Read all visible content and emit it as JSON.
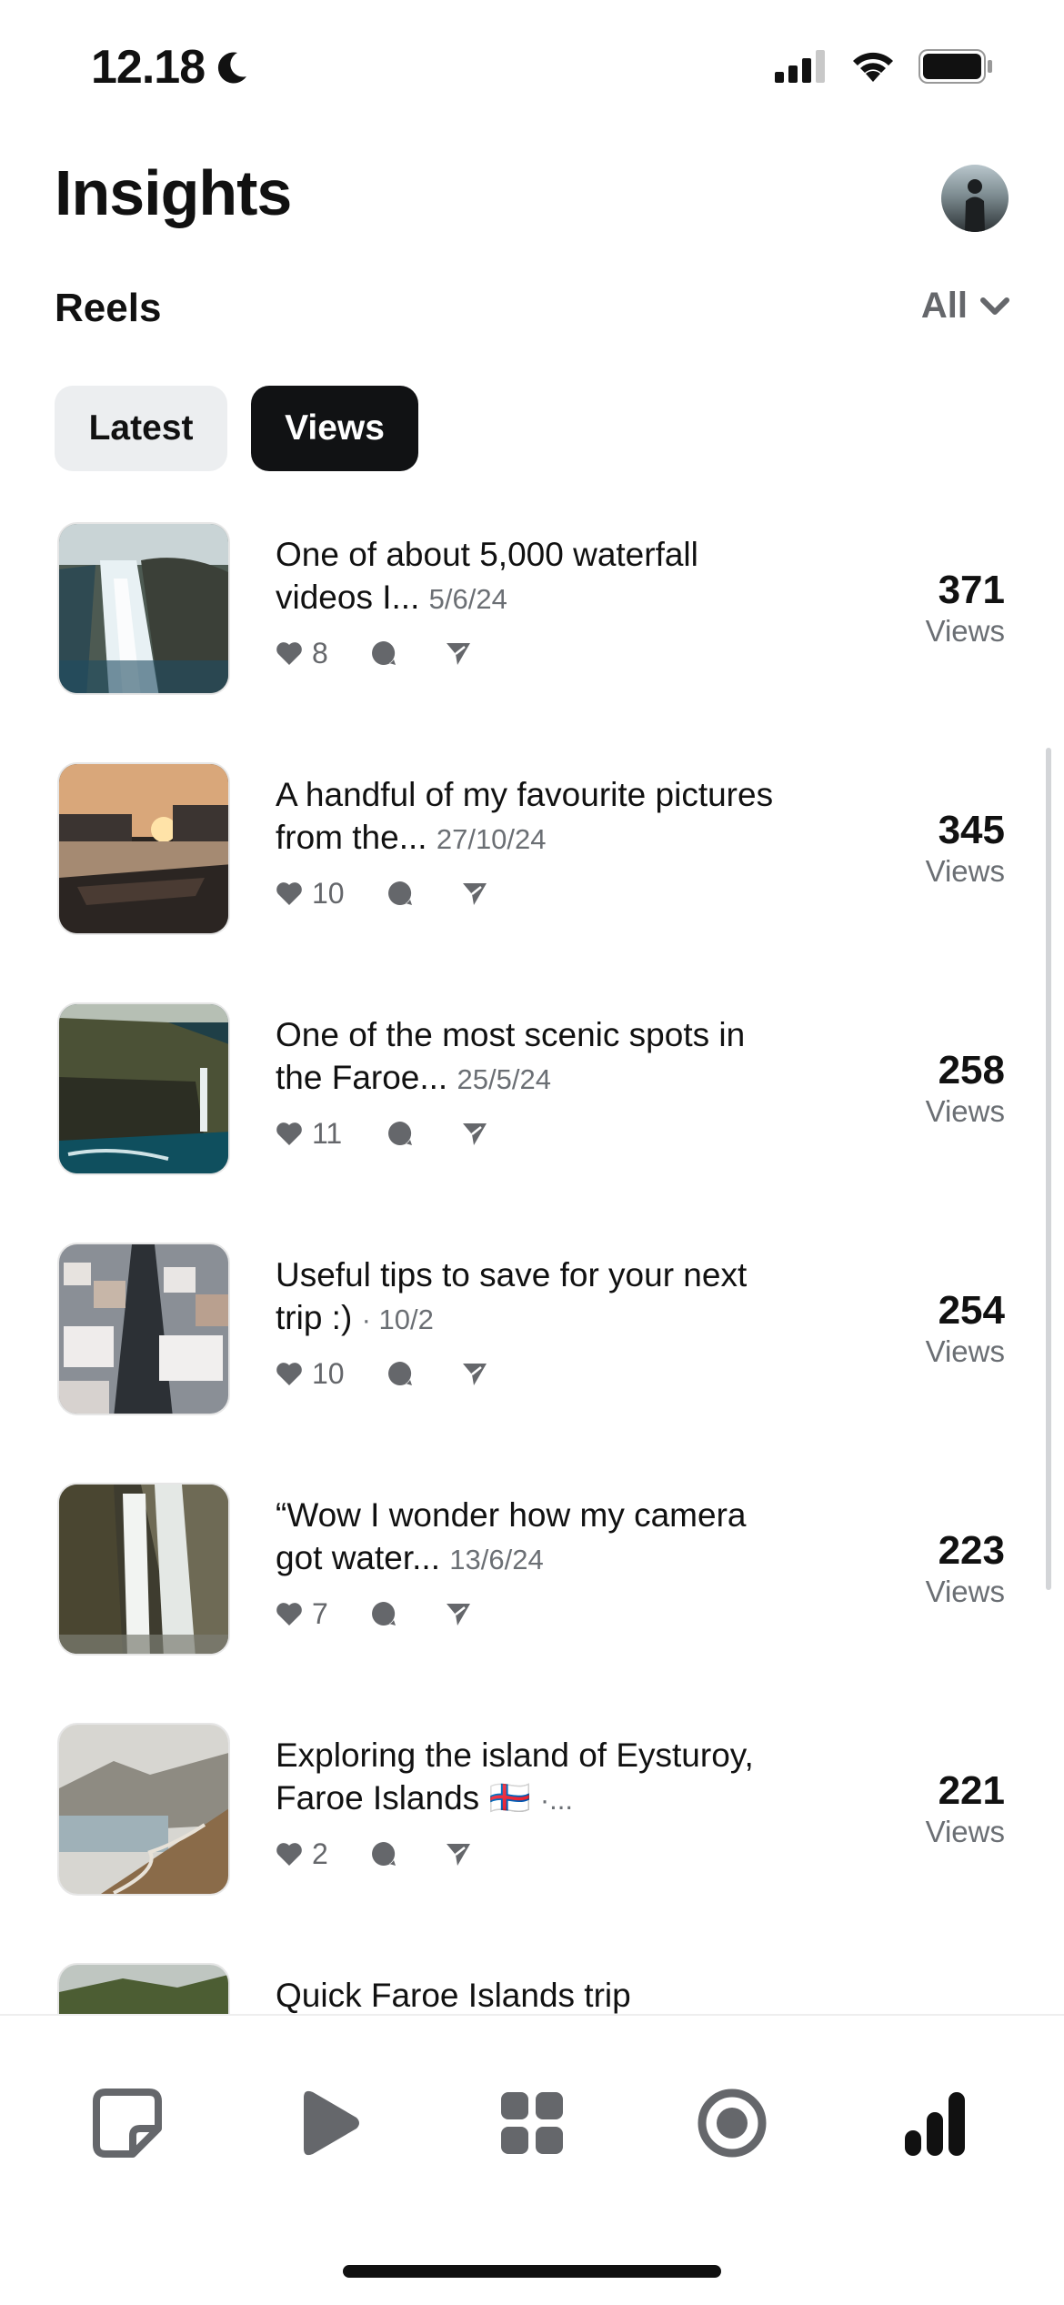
{
  "status_bar": {
    "time": "12.18",
    "moon_icon": "moon-icon",
    "signal_icon": "cellular-signal-icon",
    "wifi_icon": "wifi-icon",
    "battery_icon": "battery-icon"
  },
  "header": {
    "title": "Insights",
    "avatar_icon": "avatar"
  },
  "section": {
    "title": "Reels",
    "filter_label": "All",
    "filter_icon": "chevron-down-icon"
  },
  "tabs": [
    {
      "label": "Latest",
      "selected": false
    },
    {
      "label": "Views",
      "selected": true
    }
  ],
  "reels": [
    {
      "caption": "One of about 5,000 waterfall videos I...",
      "date": "5/6/24",
      "likes": "8",
      "views": "371",
      "views_label": "Views"
    },
    {
      "caption": "A handful of my favourite pictures from the...",
      "date": "27/10/24",
      "likes": "10",
      "views": "345",
      "views_label": "Views"
    },
    {
      "caption": "One of the most scenic spots in the Faroe...",
      "date": "25/5/24",
      "likes": "11",
      "views": "258",
      "views_label": "Views"
    },
    {
      "caption": "Useful tips to save for your next trip :)",
      "date": "· 10/2",
      "likes": "10",
      "views": "254",
      "views_label": "Views"
    },
    {
      "caption": "“Wow I wonder how my camera got water...",
      "date": "13/6/24",
      "likes": "7",
      "views": "223",
      "views_label": "Views"
    },
    {
      "caption": "Exploring the island of Eysturoy, Faroe Islands 🇫🇴",
      "date": "·...",
      "likes": "2",
      "views": "221",
      "views_label": "Views"
    },
    {
      "caption": "Quick Faroe Islands trip",
      "date": "",
      "likes": "",
      "views": "",
      "views_label": ""
    }
  ],
  "stat_icons": {
    "like": "heart-icon",
    "comment": "comment-icon",
    "share": "share-icon"
  },
  "bottom_nav": [
    {
      "icon": "posts-icon",
      "active": false
    },
    {
      "icon": "reels-play-icon",
      "active": false
    },
    {
      "icon": "grid-icon",
      "active": false
    },
    {
      "icon": "live-icon",
      "active": false
    },
    {
      "icon": "insights-bar-chart-icon",
      "active": true
    }
  ],
  "colors": {
    "accent_dark": "#111214",
    "muted": "#65676b",
    "chip_bg": "#eceef0"
  }
}
